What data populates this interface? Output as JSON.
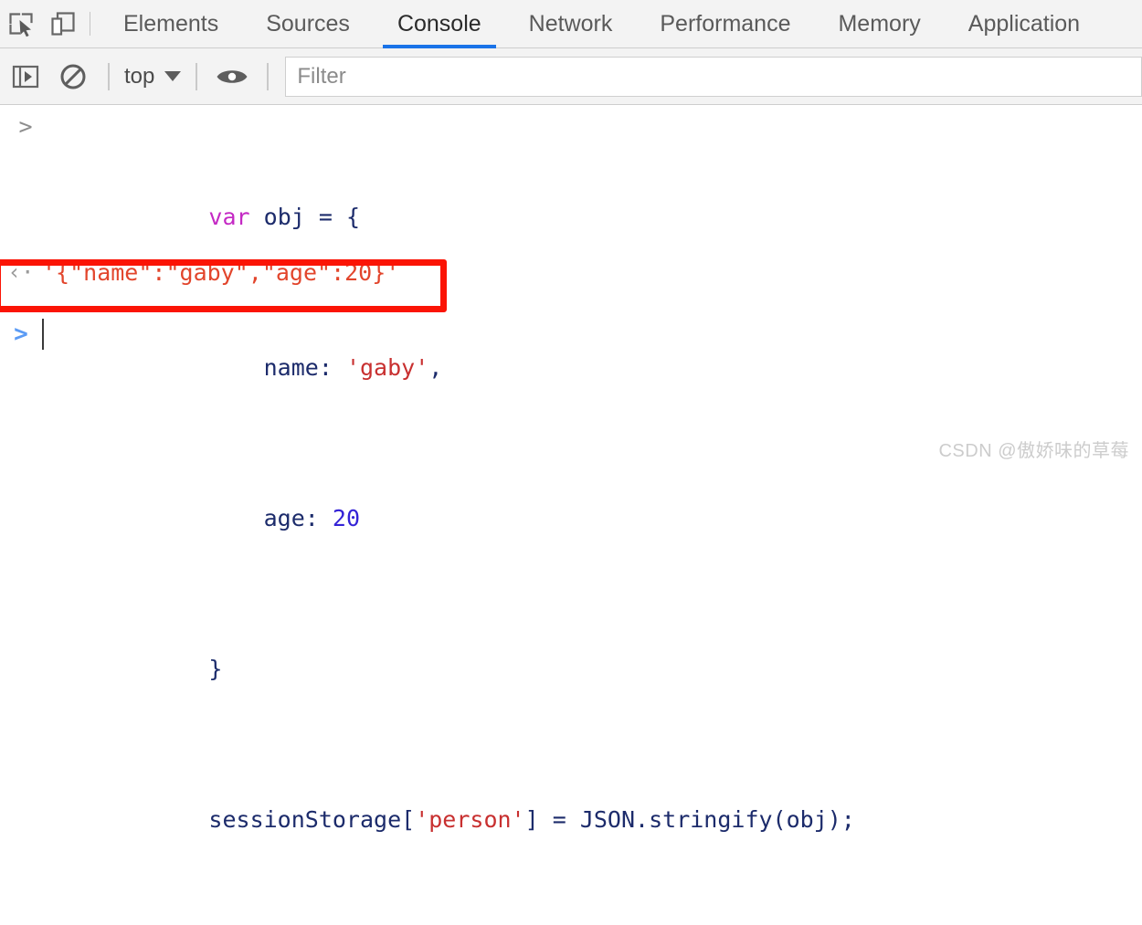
{
  "tabbar": {
    "inspect_icon": "inspect-element-icon",
    "device_icon": "device-toolbar-icon",
    "tabs": [
      {
        "label": "Elements",
        "active": false
      },
      {
        "label": "Sources",
        "active": false
      },
      {
        "label": "Console",
        "active": true
      },
      {
        "label": "Network",
        "active": false
      },
      {
        "label": "Performance",
        "active": false
      },
      {
        "label": "Memory",
        "active": false
      },
      {
        "label": "Application",
        "active": false
      }
    ],
    "active_tab": "Console",
    "active_underline_color": "#1a73e8"
  },
  "filterbar": {
    "sidebar_toggle_icon": "show-console-sidebar-icon",
    "clear_icon": "clear-console-icon",
    "context_label": "top",
    "context_caret_icon": "chevron-down-icon",
    "eye_icon": "live-expression-eye-icon",
    "filter_placeholder": "Filter",
    "filter_value": ""
  },
  "console": {
    "input_gutter_icon": ">",
    "input_lines": [
      [
        {
          "t": "var ",
          "c": "kw"
        },
        {
          "t": "obj = {",
          "c": "plain"
        }
      ],
      [
        {
          "t": "    name: ",
          "c": "plain"
        },
        {
          "t": "'gaby'",
          "c": "str"
        },
        {
          "t": ",",
          "c": "plain"
        }
      ],
      [
        {
          "t": "    age: ",
          "c": "plain"
        },
        {
          "t": "20",
          "c": "num"
        }
      ],
      [
        {
          "t": "}",
          "c": "plain"
        }
      ],
      [
        {
          "t": "sessionStorage[",
          "c": "plain"
        },
        {
          "t": "'person'",
          "c": "str"
        },
        {
          "t": "] = JSON.stringify(obj);",
          "c": "plain"
        }
      ]
    ],
    "result_gutter_icon": "‹·",
    "result_value": "'{\"name\":\"gaby\",\"age\":20}'",
    "result_color": "#e2452c",
    "prompt_chevron": ">",
    "annotation_color": "#fb1405"
  },
  "watermark": {
    "text": "CSDN @傲娇味的草莓"
  }
}
